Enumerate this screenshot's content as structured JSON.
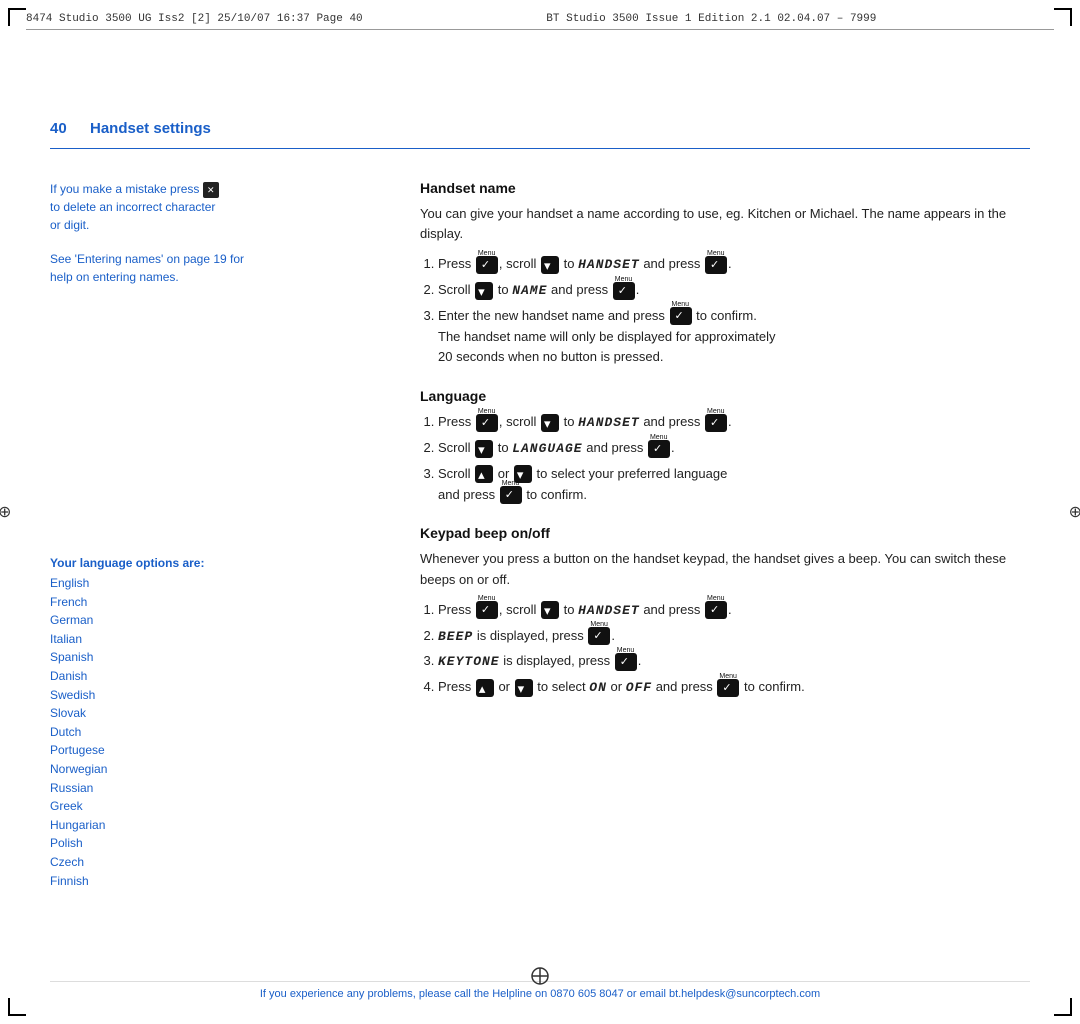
{
  "header": {
    "left_text": "8474 Studio 3500 UG Iss2 [2]   25/10/07  16:37  Page 40",
    "center_text": "BT Studio 3500   Issue 1   Edition 2.1   02.04.07 – 7999"
  },
  "page_number": "40",
  "page_title": "Handset settings",
  "left_column": {
    "note1_line1": "If you make a mistake press",
    "note1_line2": "to delete an incorrect character",
    "note1_line3": "or digit.",
    "note2_line1": "See 'Entering names' on page 19 for",
    "note2_line2": "help on entering names.",
    "language_header": "Your language options are:",
    "languages": [
      "English",
      "French",
      "German",
      "Italian",
      "Spanish",
      "Danish",
      "Swedish",
      "Slovak",
      "Dutch",
      "Portugese",
      "Norwegian",
      "Russian",
      "Greek",
      "Hungarian",
      "Polish",
      "Czech",
      "Finnish"
    ]
  },
  "sections": {
    "handset_name": {
      "title": "Handset name",
      "body": "You can give your handset a name according to use, eg. Kitchen or Michael. The name appears in the display.",
      "steps": [
        "Press  , scroll   to HANDSET and press  .",
        "Scroll   to NAME and press  .",
        "Enter the new handset name and press   to confirm. The handset name will only be displayed for approximately 20 seconds when no button is pressed."
      ]
    },
    "language": {
      "title": "Language",
      "steps": [
        "Press  , scroll   to HANDSET and press  .",
        "Scroll   to LANGUAGE and press  .",
        "Scroll   or   to select your preferred language and press   to confirm."
      ]
    },
    "keypad_beep": {
      "title": "Keypad beep on/off",
      "body": "Whenever you press a button on the handset keypad, the handset gives a beep. You can switch these beeps on or off.",
      "steps": [
        "Press  , scroll   to HANDSET and press  .",
        "BEEP is displayed, press  .",
        "KEYTONE is displayed, press  .",
        "Press   or   to select ON or OFF and press   to confirm."
      ]
    }
  },
  "footer": {
    "text": "If you experience any problems, please call the Helpline on 0870 605 8047 or email bt.helpdesk@suncorptech.com"
  }
}
